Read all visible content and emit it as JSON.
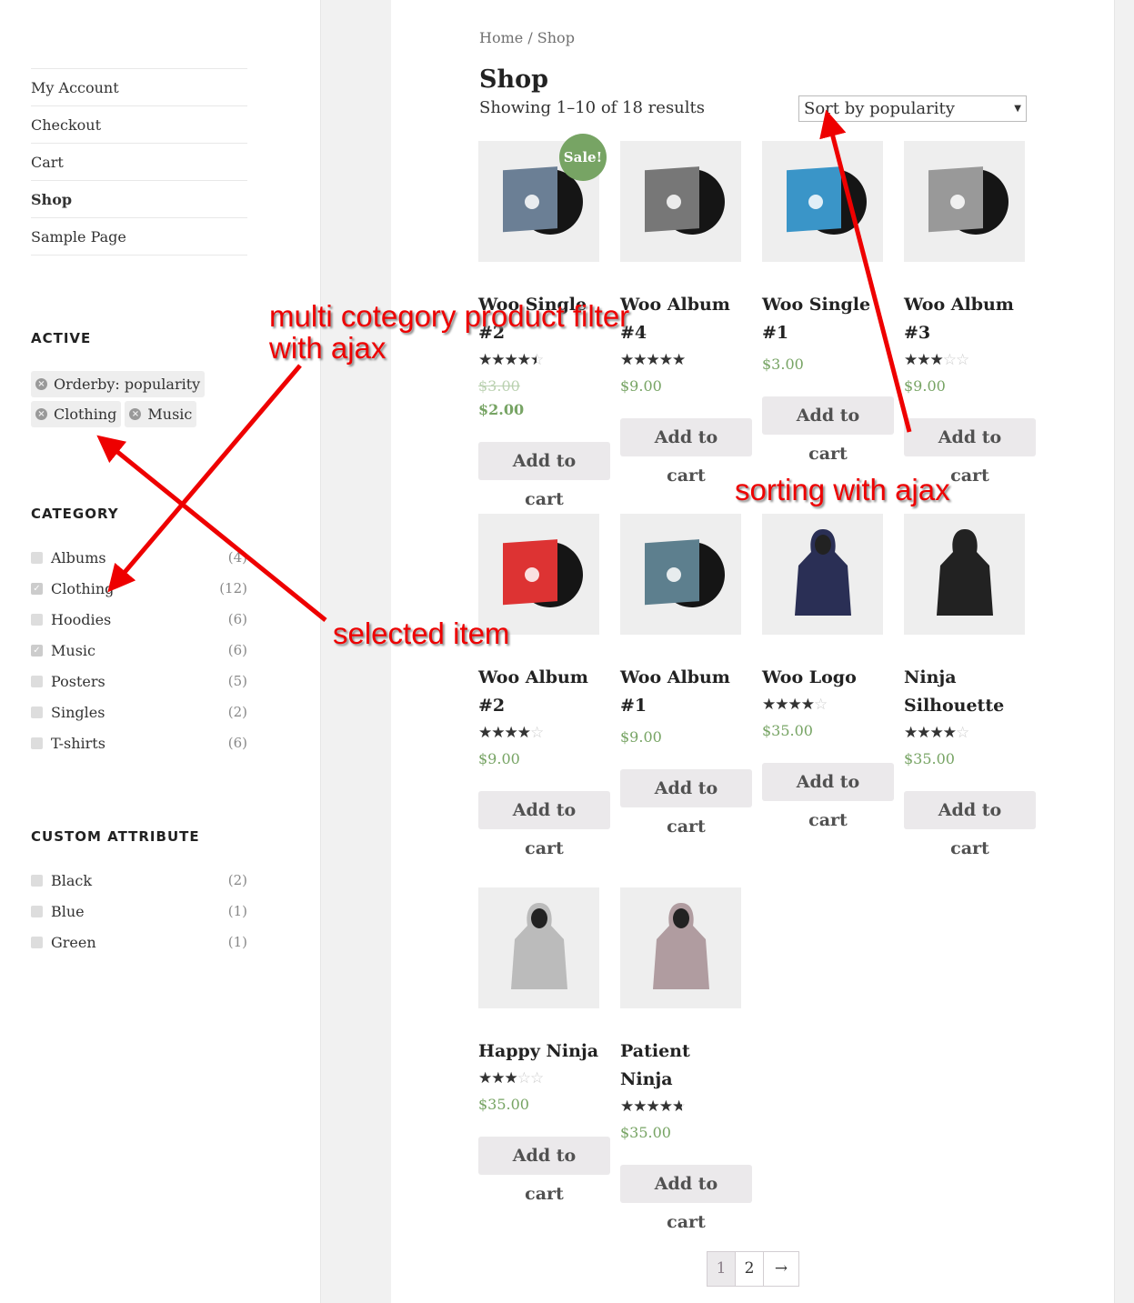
{
  "sidebar": {
    "menu": [
      "My Account",
      "Checkout",
      "Cart",
      "Shop",
      "Sample Page"
    ],
    "active_title": "ACTIVE",
    "active_filters": [
      "Orderby: popularity",
      "Clothing",
      "Music"
    ],
    "category_title": "CATEGORY",
    "categories": [
      {
        "label": "Albums",
        "count": "(4)",
        "checked": false
      },
      {
        "label": "Clothing",
        "count": "(12)",
        "checked": true
      },
      {
        "label": "Hoodies",
        "count": "(6)",
        "checked": false
      },
      {
        "label": "Music",
        "count": "(6)",
        "checked": true
      },
      {
        "label": "Posters",
        "count": "(5)",
        "checked": false
      },
      {
        "label": "Singles",
        "count": "(2)",
        "checked": false
      },
      {
        "label": "T-shirts",
        "count": "(6)",
        "checked": false
      }
    ],
    "attr_title": "CUSTOM ATTRIBUTE",
    "attributes": [
      {
        "label": "Black",
        "count": "(2)"
      },
      {
        "label": "Blue",
        "count": "(1)"
      },
      {
        "label": "Green",
        "count": "(1)"
      }
    ]
  },
  "main": {
    "breadcrumb": "Home / Shop",
    "title": "Shop",
    "result_count": "Showing 1–10 of 18 results",
    "sort": "Sort by popularity",
    "add_to_cart": "Add to cart",
    "sale_badge": "Sale!",
    "products": [
      {
        "name": "Woo Single #2",
        "rating": 4.5,
        "old_price": "$3.00",
        "price": "$2.00",
        "sale": true,
        "kind": "vinyl",
        "color": "#6b7f95"
      },
      {
        "name": "Woo Album #4",
        "rating": 5,
        "price": "$9.00",
        "kind": "vinyl",
        "color": "#777"
      },
      {
        "name": "Woo Single #1",
        "rating": null,
        "price": "$3.00",
        "kind": "vinyl",
        "color": "#3a95c8"
      },
      {
        "name": "Woo Album #3",
        "rating": 3,
        "price": "$9.00",
        "kind": "vinyl",
        "color": "#999"
      },
      {
        "name": "Woo Album #2",
        "rating": 4,
        "price": "$9.00",
        "kind": "vinyl",
        "color": "#d33"
      },
      {
        "name": "Woo Album #1",
        "rating": null,
        "price": "$9.00",
        "kind": "vinyl",
        "color": "#5d7f8e"
      },
      {
        "name": "Woo Logo",
        "rating": 4,
        "price": "$35.00",
        "kind": "hoodie",
        "color": "#2a2f55"
      },
      {
        "name": "Ninja Silhouette",
        "rating": 4,
        "price": "$35.00",
        "kind": "hoodie",
        "color": "#222"
      },
      {
        "name": "Happy Ninja",
        "rating": 3,
        "price": "$35.00",
        "kind": "hoodie",
        "color": "#bbb"
      },
      {
        "name": "Patient Ninja",
        "rating": 4.8,
        "price": "$35.00",
        "kind": "hoodie",
        "color": "#b09ca0"
      }
    ],
    "pagination": [
      "1",
      "2",
      "→"
    ]
  },
  "annotations": {
    "multi": "multi cotegory product filter\nwith ajax",
    "multi_1": "multi cotegory product filter",
    "multi_2": "with ajax",
    "sorting": "sorting with ajax",
    "selected": "selected item",
    "color": "#ee0000"
  }
}
